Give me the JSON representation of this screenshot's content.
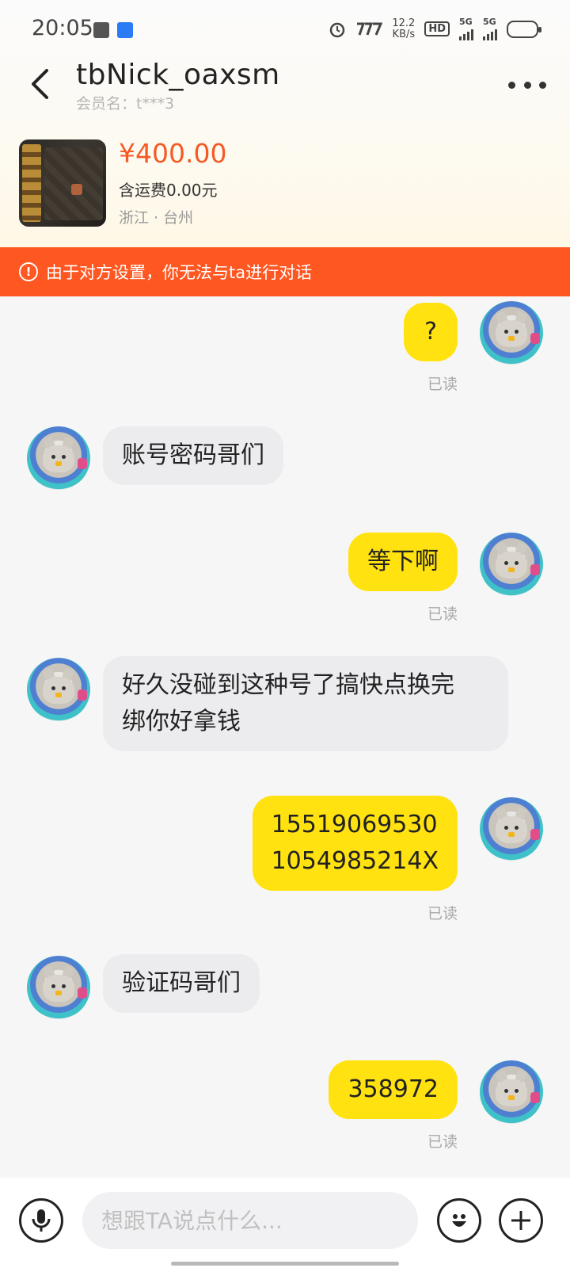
{
  "status_bar": {
    "time": "20:05",
    "net_speed_value": "12.2",
    "net_speed_unit": "KB/s",
    "hd_label": "HD",
    "sig1_label": "5G",
    "sig2_label": "5G"
  },
  "header": {
    "title": "tbNick_oaxsm",
    "member_label": "会员名：t***3"
  },
  "product": {
    "price": "¥400.00",
    "shipping": "含运费0.00元",
    "location": "浙江 · 台州"
  },
  "warning": {
    "icon": "!",
    "text": "由于对方设置，你无法与ta进行对话"
  },
  "messages": [
    {
      "side": "out",
      "text": "?",
      "status": "已读"
    },
    {
      "side": "in",
      "text": "账号密码哥们"
    },
    {
      "side": "out",
      "text": "等下啊",
      "status": "已读"
    },
    {
      "side": "in",
      "text_line1": "好久没碰到这种号了搞快点换完",
      "text_line2": "绑你好拿钱"
    },
    {
      "side": "out",
      "text_line1": "15519069530",
      "text_line2": "1054985214X",
      "status": "已读"
    },
    {
      "side": "in",
      "text": "验证码哥们"
    },
    {
      "side": "out",
      "text": "358972",
      "status": "已读"
    }
  ],
  "input": {
    "placeholder": "想跟TA说点什么..."
  },
  "colors": {
    "accent_orange": "#ff5722",
    "price_orange": "#f55a25",
    "bubble_out": "#ffe20f",
    "bubble_in": "#ececef"
  }
}
